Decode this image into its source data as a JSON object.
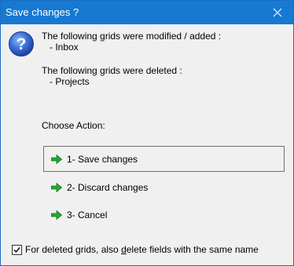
{
  "window": {
    "title": "Save changes ?",
    "close_icon": "close-icon"
  },
  "message": {
    "icon": "question-icon",
    "modified_heading": "The following grids were modified / added :",
    "modified_items": [
      "- Inbox"
    ],
    "deleted_heading": "The following grids were deleted :",
    "deleted_items": [
      "- Projects"
    ]
  },
  "choose_label": "Choose Action:",
  "actions": [
    {
      "label": "1- Save changes",
      "icon": "green-arrow-icon",
      "selected": true
    },
    {
      "label": "2- Discard changes",
      "icon": "green-arrow-icon",
      "selected": false
    },
    {
      "label": "3- Cancel",
      "icon": "green-arrow-icon",
      "selected": false
    }
  ],
  "checkbox": {
    "checked": true,
    "label_before": "For deleted grids, also ",
    "label_underlined": "d",
    "label_after": "elete fields with the same name"
  },
  "colors": {
    "titlebar": "#1779d2",
    "dialog_bg": "#f0f0f0",
    "arrow_green": "#22a832"
  }
}
